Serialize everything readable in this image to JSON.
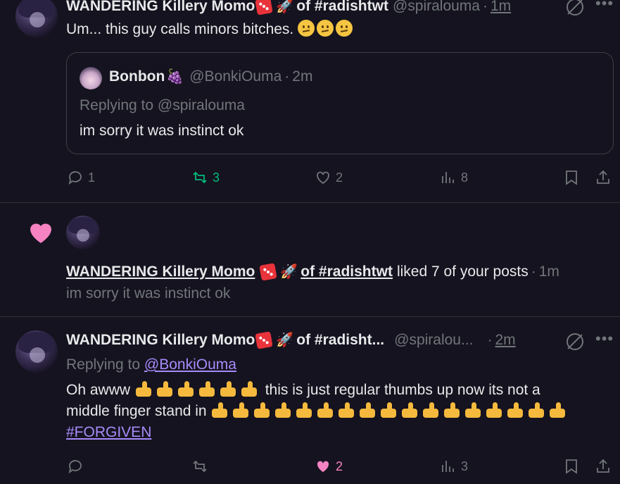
{
  "post1": {
    "author": "WANDERING Killery Momo",
    "author_suffix": "of #radishtwt",
    "handle": "@spiralouma",
    "sep": "·",
    "time": "1m",
    "text": "Um... this guy calls minors bitches.",
    "quote": {
      "author": "Bonbon",
      "handle": "@BonkiOuma",
      "time": "2m",
      "replying_prefix": "Replying to",
      "replying_to": "@spiralouma",
      "text": "im sorry it was instinct ok"
    },
    "actions": {
      "replies": "1",
      "reposts": "3",
      "likes": "2",
      "views": "8"
    }
  },
  "notification": {
    "icon": "heart-icon",
    "actor": "WANDERING Killery Momo",
    "actor_suffix": "of #radishtwt",
    "action_text": "liked 7 of your posts",
    "sep": "·",
    "time": "1m",
    "excerpt": "im sorry it was instinct ok"
  },
  "post2": {
    "author": "WANDERING Killery Momo",
    "author_suffix": "of #radisht...",
    "handle": "@spiralou...",
    "sep": "·",
    "time": "2m",
    "replying_prefix": "Replying to",
    "replying_to": "@BonkiOuma",
    "text_a": "Oh awww",
    "text_b": "this is just regular thumbs up now its not a",
    "text_c": "middle finger stand in",
    "hashtag": "#FORGIVEN",
    "actions": {
      "likes": "2",
      "views": "3"
    }
  },
  "colors": {
    "background": "#15131f",
    "accent_link": "#a78bfa",
    "repost_green": "#00ba7c",
    "like_pink": "#f91880",
    "muted": "#71767b"
  }
}
